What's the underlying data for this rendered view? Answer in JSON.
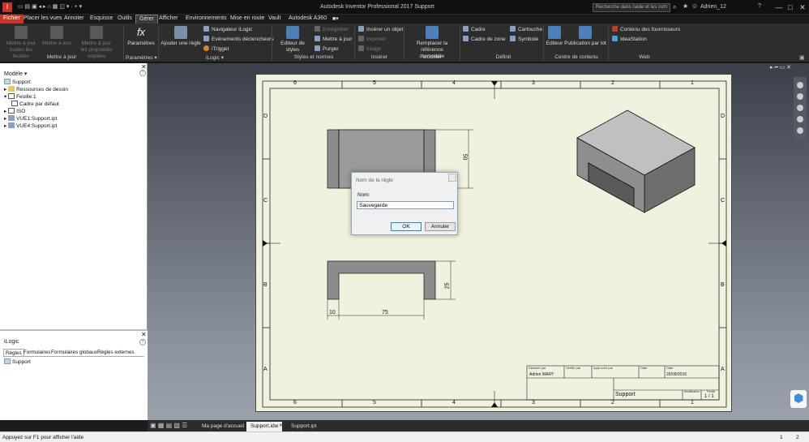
{
  "app": {
    "title": "Autodesk Inventor Professional 2017   Support",
    "search_placeholder": "Recherche dans l'aide et les com",
    "user": "Adrien_12",
    "window_buttons": [
      "—",
      "□",
      "✕"
    ]
  },
  "tabs": [
    "Fichier",
    "Placer les vues",
    "Annoter",
    "Esquisse",
    "Outils",
    "Gérer",
    "Afficher",
    "Environnements",
    "Mise en route",
    "Vault",
    "Autodesk A360"
  ],
  "ribbon": {
    "update": {
      "btn1": "Mettre à jour\ntoutes les feuilles",
      "btn2": "Mettre à jour",
      "btn3": "Mettre à jour\nles propriétés copiées",
      "group": "Mettre à jour"
    },
    "params": {
      "btn": "Paramètres",
      "group": "Paramètres ▾"
    },
    "ilogic": {
      "add_rule": "Ajouter une règle",
      "nav": "Navigateur iLogic",
      "events": "Evénements déclencheurs",
      "trigger": "iTrigger",
      "group": "iLogic ▾"
    },
    "styles": {
      "editor": "Editeur de styles",
      "save": "Enregistrer",
      "update": "Mettre à jour",
      "purge": "Purger",
      "group": "Styles et normes"
    },
    "insert": {
      "object": "Insérer un objet",
      "import": "Importer",
      "image": "Image",
      "group": "Insérer"
    },
    "modify": {
      "replace": "Remplacer la référence\ndu modèle",
      "group": "Modifier"
    },
    "define": {
      "frame": "Cadre",
      "zone": "Cadre de zone",
      "titleblock": "Cartouche",
      "symbol": "Symbole",
      "group": "Définit"
    },
    "content": {
      "editor": "Editeur",
      "batch": "Publication par lot",
      "group": "Centre de contenu"
    },
    "web": {
      "suppliers": "Contenu des fournisseurs",
      "ideastation": "IdeaStation",
      "group": "Web"
    }
  },
  "model_panel": {
    "title": "Modèle ▾",
    "tree": [
      "Support",
      "Ressources de dessin",
      "Feuille:1",
      "Cadre par défaut",
      "ISO",
      "VUE1:Support.ipt",
      "VUE4:Support.ipt"
    ]
  },
  "ilogic_panel": {
    "title": "iLogic",
    "tabs": [
      "Règles",
      "Formulaires",
      "Formulaires globaux",
      "Règles externes"
    ],
    "items": [
      "Support"
    ]
  },
  "drawing": {
    "col_numbers": [
      "6",
      "5",
      "4",
      "3",
      "2",
      "1"
    ],
    "row_letters": [
      "D",
      "C",
      "B",
      "A"
    ],
    "dims": {
      "height_top": "50",
      "height_front": "25",
      "wall": "10",
      "width": "75"
    },
    "titleblock": {
      "dessine_par_label": "Dessiné par",
      "dessine_par": "Adrien MARY",
      "verifie_par": "Vérifié par",
      "approuve_par": "Approuvé par",
      "date_label": "Date",
      "date_label2": "Date",
      "date": "26/09/2016",
      "name": "Support",
      "edition_label": "Modification",
      "sheet_label": "Feuille",
      "sheet": "1 / 1"
    }
  },
  "dialog": {
    "title": "Nom de la règle",
    "name_label": "Nom:",
    "name_value": "Sauvegarde",
    "ok": "OK",
    "cancel": "Annuler"
  },
  "bottom_tabs": [
    "Ma page d'accueil",
    "Support.idw",
    "Support.ipt"
  ],
  "status": {
    "hint": "Appuyez sur F1 pour afficher l'aide",
    "n1": "1",
    "n2": "2"
  },
  "colors": {
    "accent": "#c8362a",
    "sheet": "#f1f1df",
    "part_fill": "#8c8c8c"
  }
}
